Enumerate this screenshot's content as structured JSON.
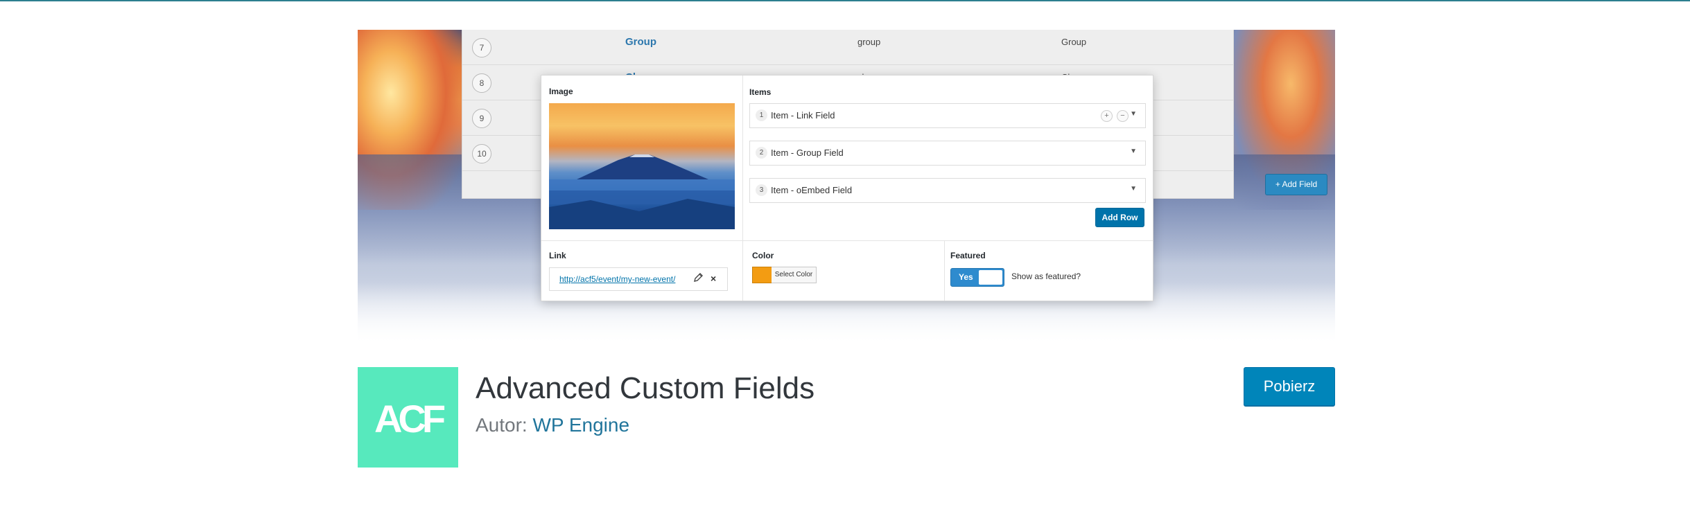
{
  "banner": {
    "back_rows": [
      {
        "num": "7",
        "label": "Group",
        "name": "group",
        "type": "Group"
      },
      {
        "num": "8",
        "label": "Clone",
        "name": "clone",
        "type": "Clone"
      },
      {
        "num": "9",
        "label": "",
        "name": "",
        "type": ""
      },
      {
        "num": "10",
        "label": "",
        "name": "",
        "type": ""
      }
    ],
    "add_field_label": "+ Add Field",
    "card": {
      "image_label": "Image",
      "items_label": "Items",
      "items": [
        {
          "num": "1",
          "label": "Item - Link Field"
        },
        {
          "num": "2",
          "label": "Item - Group Field"
        },
        {
          "num": "3",
          "label": "Item - oEmbed Field"
        }
      ],
      "add_row_label": "Add Row",
      "link_label": "Link",
      "link_url": "http://acf5/event/my-new-event/",
      "color_label": "Color",
      "color_value": "#f39c12",
      "select_color_label": "Select Color",
      "featured_label": "Featured",
      "toggle_yes": "Yes",
      "featured_text": "Show as featured?"
    }
  },
  "plugin": {
    "icon_text": "ACF",
    "icon_color": "#57e9bd",
    "title": "Advanced Custom Fields",
    "author_prefix": "Autor:",
    "author_name": "WP Engine",
    "download_label": "Pobierz"
  }
}
